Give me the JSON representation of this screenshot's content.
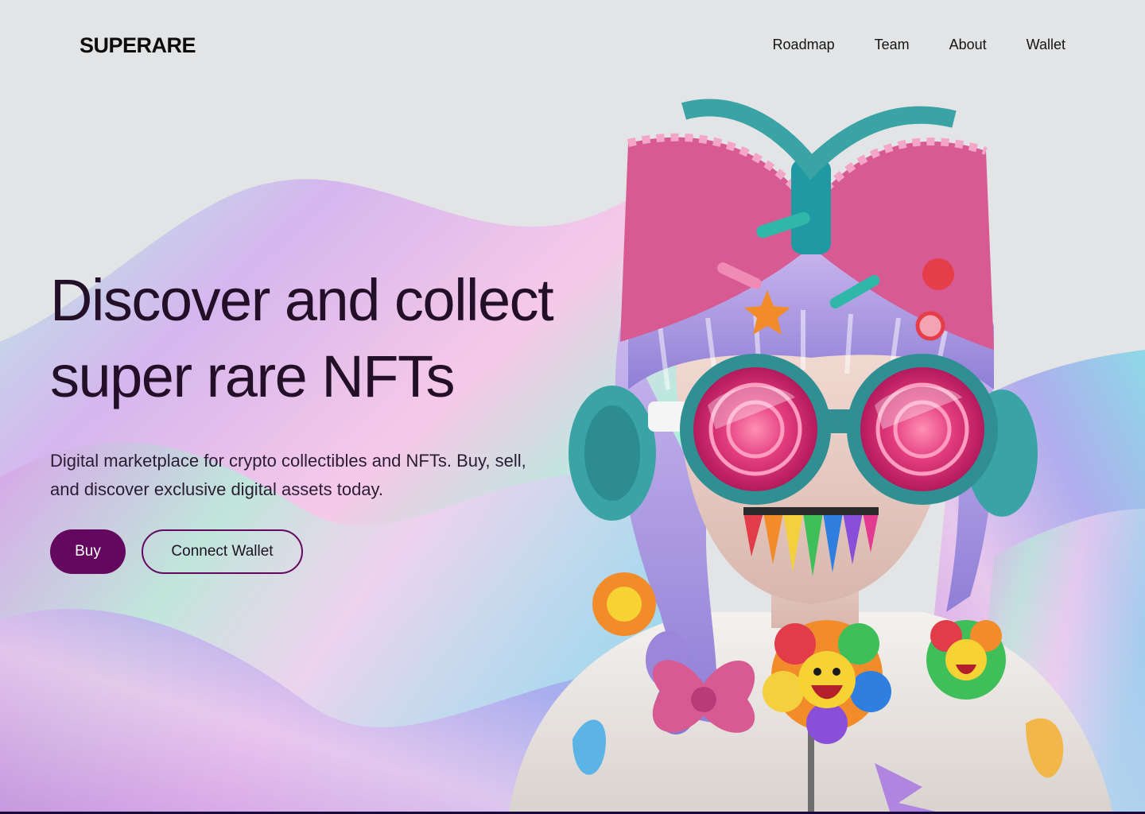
{
  "brand": {
    "logo_text": "SUPERARE"
  },
  "nav": {
    "items": [
      {
        "label": "Roadmap"
      },
      {
        "label": "Team"
      },
      {
        "label": "About"
      },
      {
        "label": "Wallet"
      }
    ]
  },
  "hero": {
    "title_line1": "Discover and collect",
    "title_line2": "super rare NFTs",
    "subtitle": "Digital marketplace for crypto collectibles and NFTs. Buy, sell, and discover exclusive digital assets today.",
    "buy_label": "Buy",
    "connect_label": "Connect Wallet"
  },
  "colors": {
    "background": "#e2e4e6",
    "accent": "#63075f",
    "heading": "#231028"
  },
  "icons": {
    "hero_art": "nft-character-illustration",
    "background_art": "holographic-wave-background"
  }
}
